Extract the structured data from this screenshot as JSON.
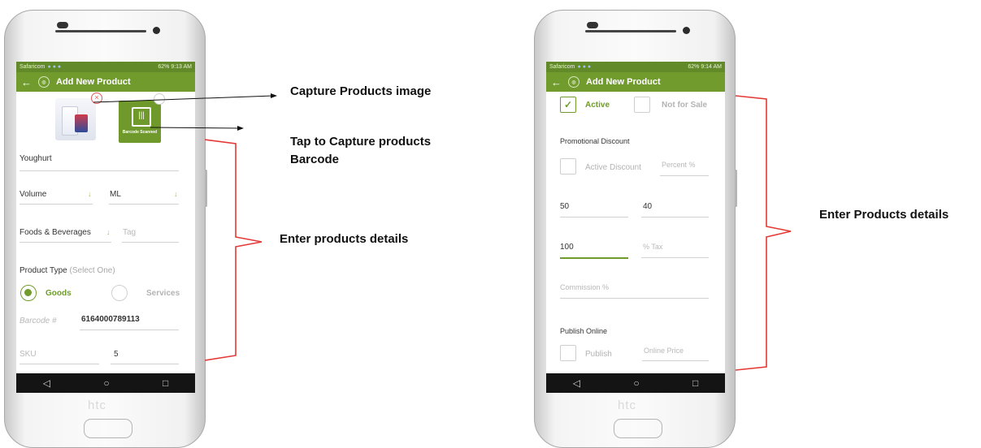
{
  "left_phone": {
    "status_left": "Safaricom",
    "status_right": "62%  9:13 AM",
    "title": "Add New Product",
    "barcode_tile_label": "Barcode Scanned",
    "product_name": "Youghurt",
    "unit_label": "Volume",
    "unit_value": "ML",
    "category": "Foods & Beverages",
    "tag_placeholder": "Tag",
    "product_type_label": "Product Type",
    "product_type_hint": "(Select One)",
    "goods_label": "Goods",
    "services_label": "Services",
    "barcode_label": "Barcode #",
    "barcode_value": "6164000789113",
    "sku_label": "SKU",
    "sku_value": "5",
    "brand": "htc"
  },
  "right_phone": {
    "status_left": "Safaricom",
    "status_right": "62%  9:14 AM",
    "title": "Add New Product",
    "active_label": "Active",
    "not_for_sale_label": "Not for Sale",
    "promo_section": "Promotional Discount",
    "active_discount_label": "Active Discount",
    "percent_placeholder": "Percent %",
    "value_1": "50",
    "value_2": "40",
    "value_3": "100",
    "tax_placeholder": "% Tax",
    "commission_placeholder": "Commission %",
    "publish_section": "Publish Online",
    "publish_label": "Publish",
    "online_price_placeholder": "Online Price",
    "brand": "htc"
  },
  "annotations": {
    "capture_image": "Capture Products image",
    "capture_barcode_line1": "Tap to Capture products",
    "capture_barcode_line2": "Barcode",
    "enter_details_left": "Enter products details",
    "enter_details_right": "Enter Products details"
  },
  "colors": {
    "app_green": "#719c2d",
    "bracket_red": "#e53935"
  }
}
